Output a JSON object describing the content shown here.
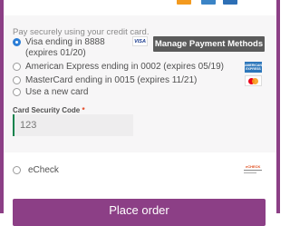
{
  "payment": {
    "intro": "Pay securely using your credit card.",
    "saved_cards": [
      {
        "label": "Visa ending in 8888 (expires 01/20)",
        "checked": true,
        "brand_icon": "visa-icon"
      },
      {
        "label": "American Express ending in 0002 (expires 05/19)",
        "checked": false,
        "brand_icon": "amex-icon"
      },
      {
        "label": "MasterCard ending in 0015 (expires 11/21)",
        "checked": false,
        "brand_icon": "mastercard-icon"
      }
    ],
    "new_card_label": "Use a new card",
    "manage_button": "Manage Payment Methods",
    "visa_badge": "VISA",
    "csc_label": "Card Security Code",
    "csc_required_mark": "*",
    "csc_value": "123",
    "echeck_label": "eCheck",
    "echeck_icon": "echeck-icon",
    "place_order_label": "Place order"
  },
  "colors": {
    "accent": "#8c3f86",
    "manage_button_bg": "#5b5b5b",
    "radio_checked": "#2c7ed6",
    "input_focus_border": "#0f834d",
    "panel_bg": "#f7f6f7"
  }
}
